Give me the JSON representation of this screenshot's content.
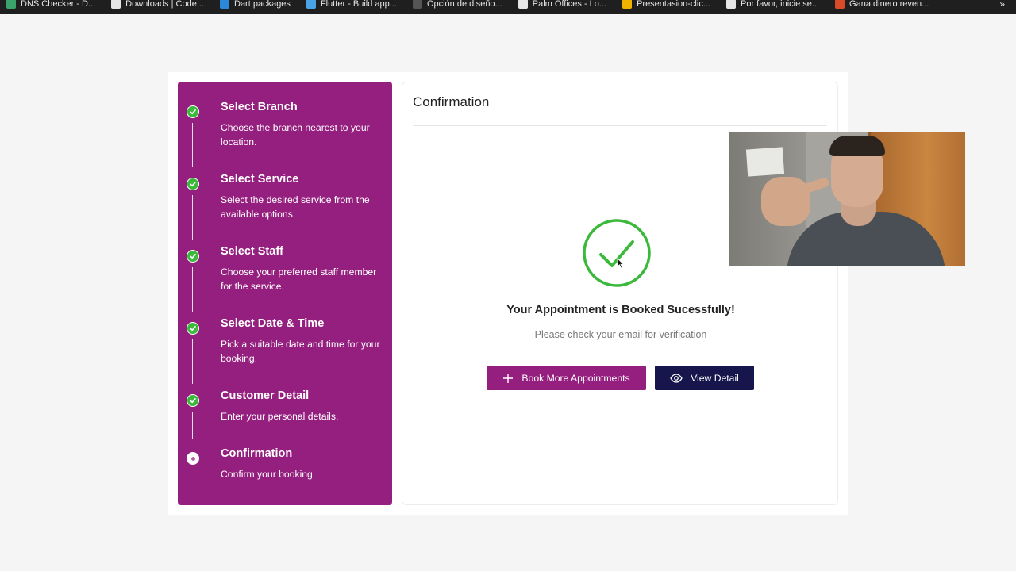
{
  "bookmarks": [
    {
      "label": "DNS Checker - D...",
      "icon_color": "#3aa36b"
    },
    {
      "label": "Downloads | Code...",
      "icon_color": "#e6e6e6"
    },
    {
      "label": "Dart packages",
      "icon_color": "#2b87d8"
    },
    {
      "label": "Flutter - Build app...",
      "icon_color": "#4aa3e6"
    },
    {
      "label": "Opción de diseño...",
      "icon_color": "#555555"
    },
    {
      "label": "Palm Offices - Lo...",
      "icon_color": "#e6e6e6"
    },
    {
      "label": "Presentasion-clic...",
      "icon_color": "#f0b400"
    },
    {
      "label": "Por favor, inicie se...",
      "icon_color": "#e6e6e6"
    },
    {
      "label": "Gana dinero reven...",
      "icon_color": "#d94a2a"
    }
  ],
  "bookmarks_more": "»",
  "steps": [
    {
      "title": "Select Branch",
      "desc": "Choose the branch nearest to your location.",
      "status": "done"
    },
    {
      "title": "Select Service",
      "desc": "Select the desired service from the available options.",
      "status": "done"
    },
    {
      "title": "Select Staff",
      "desc": "Choose your preferred staff member for the service.",
      "status": "done"
    },
    {
      "title": "Select Date & Time",
      "desc": "Pick a suitable date and time for your booking.",
      "status": "done"
    },
    {
      "title": "Customer Detail",
      "desc": "Enter your personal details.",
      "status": "done"
    },
    {
      "title": "Confirmation",
      "desc": "Confirm your booking.",
      "status": "current"
    }
  ],
  "main": {
    "title": "Confirmation",
    "success_message": "Your Appointment is Booked Sucessfully!",
    "verification_message": "Please check your email for verification",
    "book_more_label": "Book More Appointments",
    "view_detail_label": "View Detail"
  },
  "colors": {
    "sidebar": "#951f7e",
    "success_green": "#3cb93c",
    "view_detail_button": "#16164d",
    "book_more_button": "#951f7e"
  },
  "icons": {
    "step_done": "check-circle-icon",
    "step_current": "radio-dot-icon",
    "success": "check-ring-icon",
    "book_more": "plus-icon",
    "view_detail": "eye-icon"
  }
}
